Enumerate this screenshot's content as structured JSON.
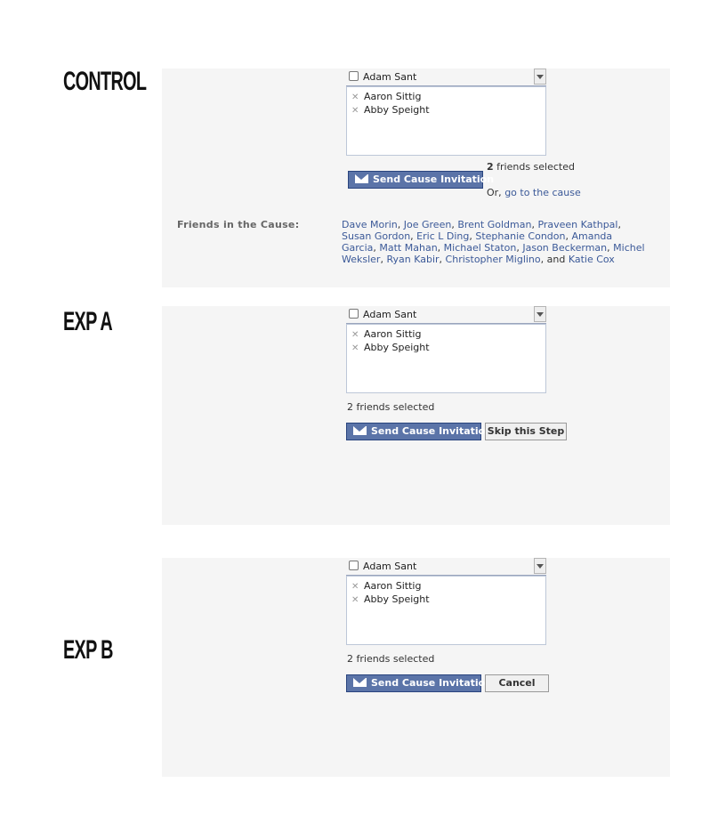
{
  "variants": [
    {
      "label": "CONTROL",
      "dropdown_name": "Adam Sant",
      "selected_friends": [
        "Aaron Sittig",
        "Abby Speight"
      ],
      "count": "2",
      "count_text": "friends selected",
      "send_label": "Send Cause Invitation",
      "or_text": "Or,",
      "goto_link": "go to the cause",
      "friends_label": "Friends in the Cause:",
      "friends_in_cause": [
        "Dave Morin",
        "Joe Green",
        "Brent Goldman",
        "Praveen Kathpal",
        "Susan Gordon",
        "Eric L Ding",
        "Stephanie Condon",
        "Amanda Garcia",
        "Matt Mahan",
        "Michael Staton",
        "Jason Beckerman",
        "Michel Weksler",
        "Ryan Kabir",
        "Christopher Miglino",
        "Katie Cox"
      ],
      "and_word": "and"
    },
    {
      "label": "EXP A",
      "dropdown_name": "Adam Sant",
      "selected_friends": [
        "Aaron Sittig",
        "Abby Speight"
      ],
      "count_text": "2 friends selected",
      "send_label": "Send Cause Invitation",
      "secondary_label": "Skip this Step"
    },
    {
      "label": "EXP B",
      "dropdown_name": "Adam Sant",
      "selected_friends": [
        "Aaron Sittig",
        "Abby Speight"
      ],
      "count_text": "2 friends selected",
      "send_label": "Send Cause Invitation",
      "secondary_label": "Cancel"
    }
  ],
  "colors": {
    "panel_bg": "#f5f5f5",
    "button_blue": "#5b74a8",
    "link_blue": "#3b5998"
  },
  "icons": [
    "checkbox-icon",
    "dropdown-arrow-icon",
    "remove-x-icon",
    "envelope-icon"
  ]
}
